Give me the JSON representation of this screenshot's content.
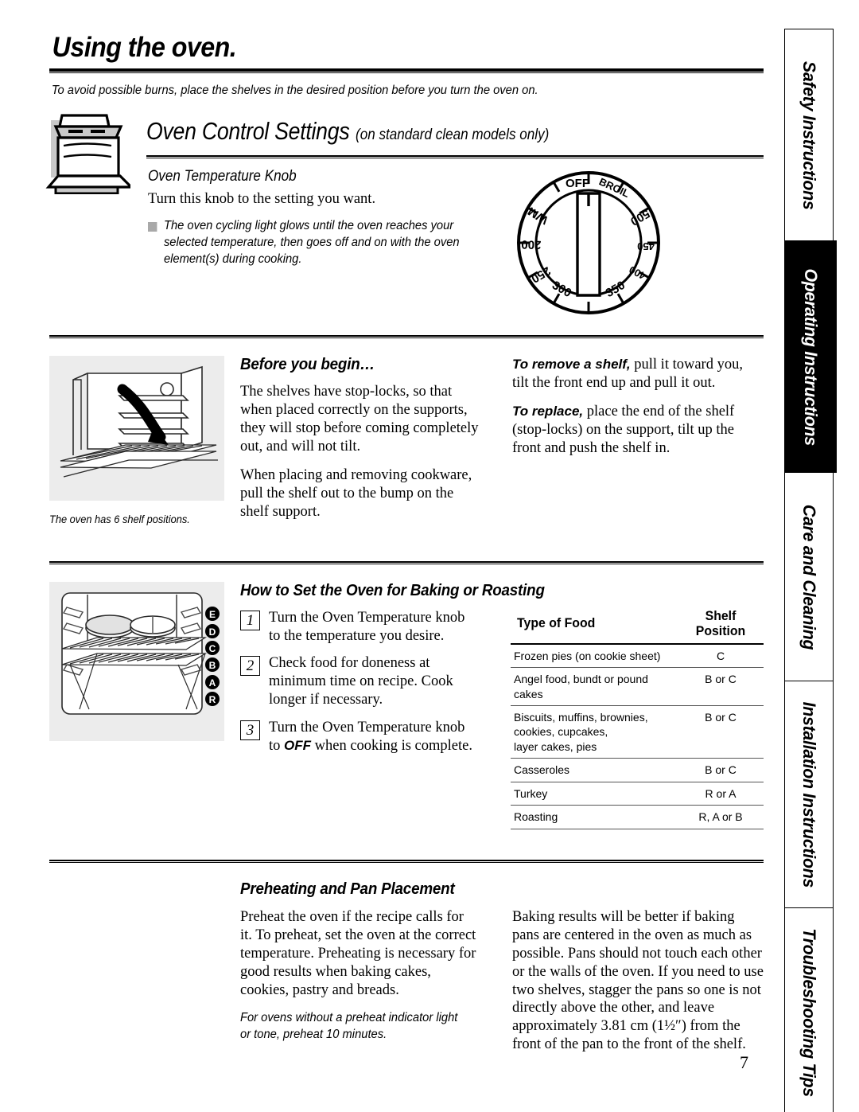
{
  "page": {
    "title": "Using the oven.",
    "lead_note": "To avoid possible burns, place the shelves in the desired position before you turn the oven on.",
    "page_number": "7"
  },
  "section_header": {
    "main": "Oven Control Settings",
    "sub": "(on standard clean models only)",
    "icon": "range-stove-icon"
  },
  "knob": {
    "heading": "Oven Temperature Knob",
    "intro": "Turn this knob to the setting you want.",
    "bullet": "The oven cycling light glows until the oven reaches your selected temperature, then goes off and on with the oven element(s) during cooking.",
    "dial_labels": [
      "OFF",
      "BROIL",
      "500",
      "450",
      "400",
      "350",
      "300",
      "250",
      "200",
      "WM"
    ]
  },
  "before_you_begin": {
    "title": "Before you begin…",
    "figure_caption": "The oven has 6 shelf positions.",
    "left_paragraphs": [
      "The shelves have stop-locks, so that when placed correctly on the supports, they will stop before coming completely out, and will not tilt.",
      "When placing and removing cookware, pull the shelf out to the bump on the shelf support."
    ],
    "right_paragraphs": [
      {
        "lead": "To remove a shelf,",
        "text": " pull it toward you, tilt the front end up and pull it out."
      },
      {
        "lead": "To replace,",
        "text": " place the end of the shelf (stop-locks) on the support, tilt up the front and push the shelf in."
      }
    ]
  },
  "baking": {
    "title": "How to Set the Oven for Baking or Roasting",
    "steps": [
      {
        "num": "1",
        "text": "Turn the Oven Temperature knob to the temperature you desire.",
        "bold_lead": ""
      },
      {
        "num": "2",
        "text": "Check food for doneness at minimum time on recipe. Cook longer if necessary.",
        "bold_lead": ""
      },
      {
        "num": "3",
        "text": " when cooking is complete.",
        "bold_lead": "OFF",
        "prefix": "Turn the Oven Temperature knob to "
      }
    ],
    "shelf_diagram_labels": [
      "E",
      "D",
      "C",
      "B",
      "A",
      "R"
    ],
    "table": {
      "headers": [
        "Type of Food",
        "Shelf Position"
      ],
      "rows": [
        {
          "food": "Frozen pies (on cookie sheet)",
          "position": "C"
        },
        {
          "food": "Angel food, bundt or pound cakes",
          "position": "B or C"
        },
        {
          "food": "Biscuits, muffins, brownies,\ncookies, cupcakes,\nlayer cakes, pies",
          "position": "B or C"
        },
        {
          "food": "Casseroles",
          "position": "B or C"
        },
        {
          "food": "Turkey",
          "position": "R or A"
        },
        {
          "food": "Roasting",
          "position": "R, A or B"
        }
      ]
    }
  },
  "preheating": {
    "title": "Preheating and Pan Placement",
    "left_paragraph": "Preheat the oven if the recipe calls for it. To preheat, set the oven at the correct temperature. Preheating is necessary for good results when baking cakes, cookies, pastry and breads.",
    "left_italic_note": "For ovens without a preheat indicator light or tone, preheat 10 minutes.",
    "right_paragraph": "Baking results will be better if baking pans are centered in the oven as much as possible. Pans should not touch each other or the walls of the oven. If you need to use two shelves, stagger the pans so one is not directly above the other, and leave approximately 3.81 cm (1½″) from the front of the pan to the front of the shelf."
  },
  "tabs": [
    {
      "label": "Safety Instructions",
      "active": false
    },
    {
      "label": "Operating Instructions",
      "active": true
    },
    {
      "label": "Care and Cleaning",
      "active": false
    },
    {
      "label": "Installation Instructions",
      "active": false
    },
    {
      "label": "Troubleshooting Tips",
      "active": false
    }
  ]
}
